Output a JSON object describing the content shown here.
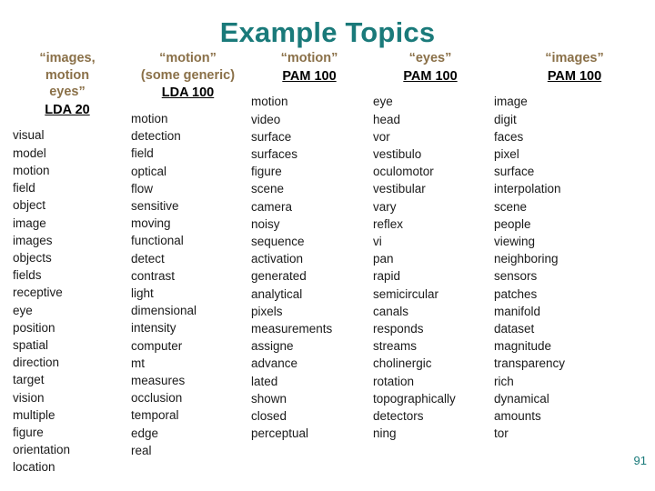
{
  "slide": {
    "title": "Example Topics",
    "page_number": "91",
    "accent_color": "#1a7a7a",
    "header_color": "#8a7048",
    "body_color": "#1a1a1a",
    "background_color": "#ffffff"
  },
  "columns": [
    {
      "header": "“images,\nmotion\neyes”",
      "model": "LDA 20",
      "words": [
        "visual",
        "model",
        "motion",
        "field",
        "object",
        "image",
        "images",
        "objects",
        "fields",
        "receptive",
        "eye",
        "position",
        "spatial",
        "direction",
        "target",
        "vision",
        "multiple",
        "figure",
        "orientation",
        "location"
      ]
    },
    {
      "header": "“motion”\n(some generic)",
      "model": "LDA 100",
      "words": [
        "motion",
        "detection",
        "field",
        "optical",
        "flow",
        "sensitive",
        "moving",
        "functional",
        "detect",
        "contrast",
        "light",
        "dimensional",
        "intensity",
        "computer",
        "mt",
        "measures",
        "occlusion",
        "temporal",
        "edge",
        "real"
      ]
    },
    {
      "header": "“motion”",
      "model": "PAM 100",
      "words": [
        "motion",
        "video",
        "surface",
        "surfaces",
        "figure",
        "scene",
        "camera",
        "noisy",
        "sequence",
        "activation",
        "generated",
        "analytical",
        "pixels",
        "measurements",
        "assigne",
        "advance",
        "lated",
        "shown",
        "closed",
        "perceptual"
      ]
    },
    {
      "header": "“eyes”",
      "model": "PAM 100",
      "words": [
        "eye",
        "head",
        "vor",
        "vestibulo",
        "oculomotor",
        "vestibular",
        "vary",
        "reflex",
        "vi",
        "pan",
        "rapid",
        "semicircular",
        "canals",
        "responds",
        "streams",
        "cholinergic",
        "rotation",
        "topographically",
        "detectors",
        "ning"
      ]
    },
    {
      "header": "“images”",
      "model": "PAM 100",
      "words": [
        "image",
        "digit",
        "faces",
        "pixel",
        "surface",
        "interpolation",
        "scene",
        "people",
        "viewing",
        "neighboring",
        "sensors",
        "patches",
        "manifold",
        "dataset",
        "magnitude",
        "transparency",
        "rich",
        "dynamical",
        "amounts",
        "tor"
      ]
    }
  ]
}
